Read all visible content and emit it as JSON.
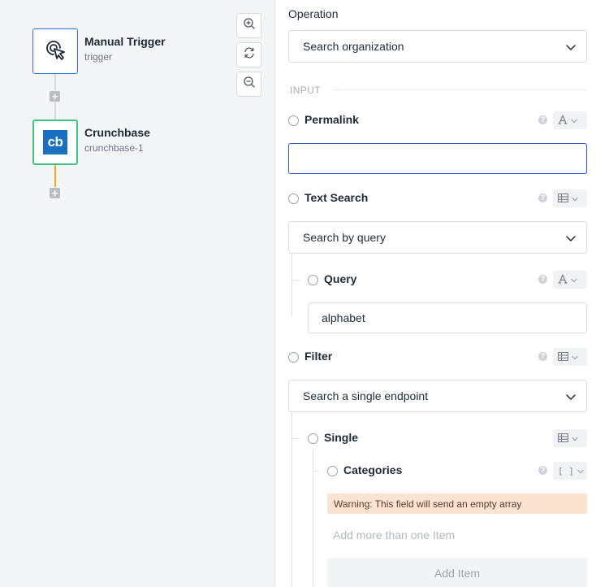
{
  "canvas": {
    "nodes": [
      {
        "title": "Manual Trigger",
        "subtitle": "trigger",
        "icon": "cursor-click-icon"
      },
      {
        "title": "Crunchbase",
        "subtitle": "crunchbase-1",
        "logo_text": "cb",
        "icon": "crunchbase-logo-icon"
      }
    ],
    "zoom_controls": [
      "zoom-in-icon",
      "refresh-icon",
      "zoom-out-icon"
    ],
    "colors": {
      "trigger_border": "#3d6bd6",
      "active_border": "#3ec382",
      "connector_active": "#f5a623",
      "crunchbase_blue": "#1a6fc0"
    }
  },
  "panel": {
    "operation_label": "Operation",
    "operation_value": "Search organization",
    "section_input": "INPUT",
    "fields": {
      "permalink": {
        "label": "Permalink",
        "value": "",
        "type_icon": "text-type-icon"
      },
      "text_search": {
        "label": "Text Search",
        "mode": "Search by query",
        "type_icon": "table-type-icon"
      },
      "query": {
        "label": "Query",
        "value": "alphabet",
        "type_icon": "text-type-icon"
      },
      "filter": {
        "label": "Filter",
        "mode": "Search a single endpoint",
        "type_icon": "table-type-icon"
      },
      "single": {
        "label": "Single",
        "type_icon": "table-type-icon"
      },
      "categories": {
        "label": "Categories",
        "type_icon": "array-type-icon",
        "type_text": "[ ]",
        "warning": "Warning: This field will send an empty array",
        "placeholder": "Add more than one Item",
        "add_button": "Add Item"
      }
    }
  }
}
